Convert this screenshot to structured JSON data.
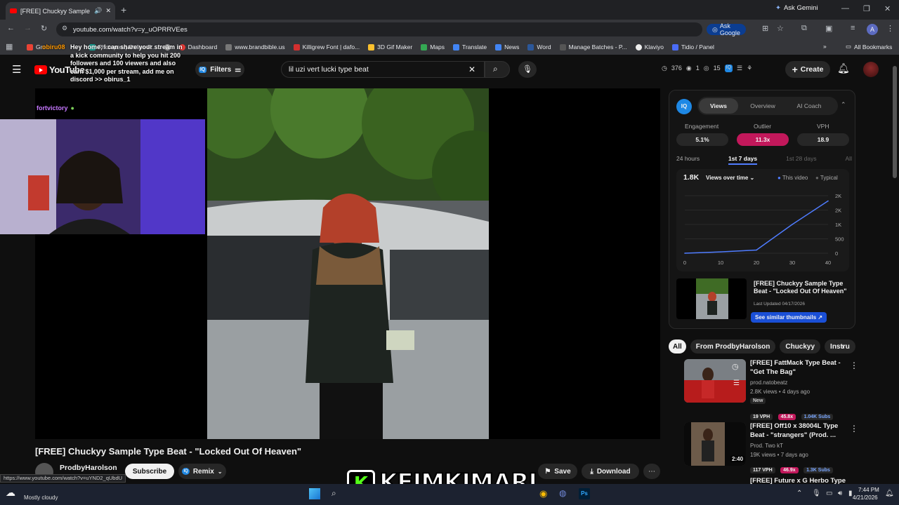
{
  "browser": {
    "tab_title": "[FREE] Chuckyy Sample Typ",
    "new_tab": "+",
    "ask_gemini": "Ask Gemini",
    "url": "youtube.com/watch?v=y_uOPRRVEes",
    "ask_google": "Ask Google",
    "all_bookmarks": "All Bookmarks",
    "bookmarks": [
      {
        "label": "Gm",
        "color": "#ea4335"
      },
      {
        "label": "",
        "color": "#888"
      },
      {
        "label": "Photopea | Online P...",
        "color": "#18a497"
      },
      {
        "label": "",
        "color": "#aaa"
      },
      {
        "label": "Dashboard",
        "color": "#e53935"
      },
      {
        "label": "www.brandbible.us",
        "color": "#777"
      },
      {
        "label": "Killigrew Font | dafo...",
        "color": "#d32f2f"
      },
      {
        "label": "3D Gif Maker",
        "color": "#fbc02d"
      },
      {
        "label": "Maps",
        "color": "#34a853"
      },
      {
        "label": "Translate",
        "color": "#4285f4"
      },
      {
        "label": "News",
        "color": "#4285f4"
      },
      {
        "label": "Word",
        "color": "#2b579a"
      },
      {
        "label": "Manage Batches - P...",
        "color": "#333"
      },
      {
        "label": "Klaviyo",
        "color": "#eee"
      },
      {
        "label": "Tidio / Panel",
        "color": "#4a6cf7"
      }
    ]
  },
  "youtube": {
    "logo": "YouTube",
    "filters": "Filters",
    "search_query": "lil uzi vert lucki type beat",
    "stats": {
      "time": "376",
      "a": "1",
      "b": "15"
    },
    "create": "Create",
    "video_title": "[FREE] Chuckyy Sample Type Beat - \"Locked Out Of Heaven\"",
    "channel": "ProdbyHarolson",
    "subscribe": "Subscribe",
    "remix": "Remix",
    "save": "Save",
    "download": "Download",
    "status_url": "https://www.youtube.com/watch?v=uYND2_qUbdU"
  },
  "overlay": {
    "chat_user": "obiru08",
    "chat_text": "Hey home, I can share your stream in a kick community to help you hit 200 followers and 100 viewers and also earn $1,000 per stream, add me on discord >> obirus_1",
    "viewer": "fortvictory",
    "banner": "KEIMKIMARI"
  },
  "iq": {
    "logo": "IQ",
    "tabs": [
      "Views",
      "Overview",
      "AI Coach"
    ],
    "metrics": [
      {
        "label": "Engagement",
        "value": "5.1%"
      },
      {
        "label": "Outlier",
        "value": "11.3x"
      },
      {
        "label": "VPH",
        "value": "18.9"
      }
    ],
    "ranges": [
      "24 hours",
      "1st 7 days",
      "1st 28 days",
      "All"
    ],
    "total": "1.8K",
    "dropdown": "Views over time",
    "legend_this": "This video",
    "legend_typical": "Typical",
    "card_title": "[FREE] Chuckyy Sample Type Beat - \"Locked Out Of Heaven\"",
    "card_updated": "Last Updated 04/17/2026",
    "similar": "See similar thumbnails",
    "accent": "#4f7cff",
    "outlier_color": "#c2185b"
  },
  "chart_data": {
    "type": "line",
    "x": [
      0,
      10,
      20,
      30,
      40
    ],
    "series": [
      {
        "name": "This video",
        "values": [
          0,
          50,
          120,
          1100,
          2000
        ]
      }
    ],
    "xticks": [
      "0",
      "10",
      "20",
      "30",
      "40"
    ],
    "yticks": [
      "2K",
      "2K",
      "1K",
      "500",
      "0"
    ],
    "ylim": [
      0,
      2200
    ]
  },
  "chips": [
    "All",
    "From ProdbyHarolson",
    "Chuckyy",
    "Instru"
  ],
  "recs": [
    {
      "title": "[FREE] FattMack Type Beat - \"Get The Bag\"",
      "channel": "prod.natobeatz",
      "meta": "2.8K views • 4 days ago",
      "tag": "New",
      "vph": "19 VPH",
      "outlier": "45.8x",
      "subs": "1.04K Subs",
      "duration": ""
    },
    {
      "title": "[FREE] Off10 x 38004L Type Beat - \"strangers\" (Prod. ...",
      "channel": "Prod. Two kT",
      "meta": "19K views • 7 days ago",
      "tag": "",
      "vph": "117 VPH",
      "outlier": "46.9x",
      "subs": "1.3K Subs",
      "duration": "2:40"
    },
    {
      "title": "[FREE] Future x G Herbo Type",
      "channel": "",
      "meta": "",
      "tag": "",
      "vph": "",
      "outlier": "",
      "subs": "",
      "duration": ""
    }
  ],
  "taskbar": {
    "weather": "Mostly cloudy",
    "time": "7:44 PM",
    "date": "4/21/2026"
  }
}
